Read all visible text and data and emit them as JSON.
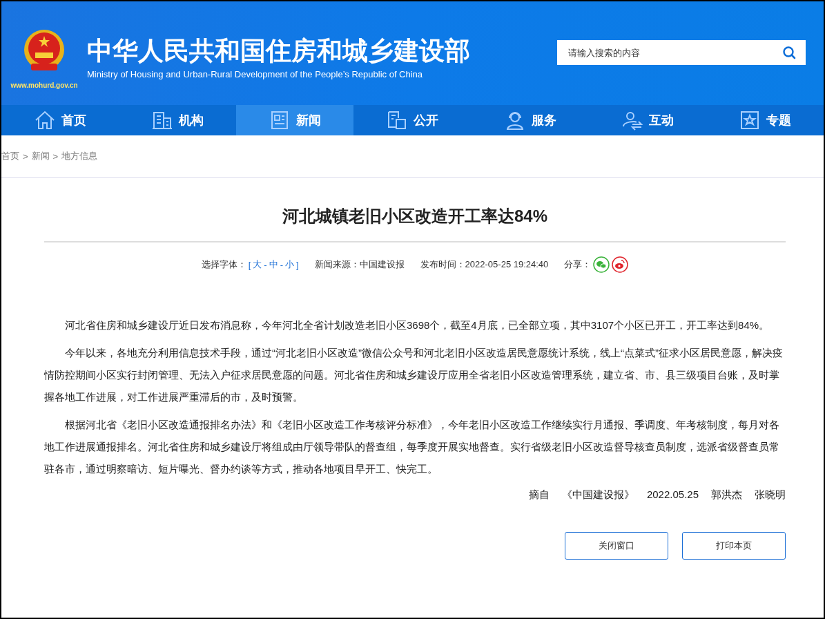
{
  "header": {
    "title": "中华人民共和国住房和城乡建设部",
    "subtitle": "Ministry of Housing and Urban-Rural Development of the People’s Republic of China",
    "url": "www.mohurd.gov.cn",
    "search": {
      "placeholder": "请输入搜索的内容"
    }
  },
  "nav": [
    {
      "label": "首页",
      "selected": false
    },
    {
      "label": "机构",
      "selected": false
    },
    {
      "label": "新闻",
      "selected": true
    },
    {
      "label": "公开",
      "selected": false
    },
    {
      "label": "服务",
      "selected": false
    },
    {
      "label": "互动",
      "selected": false
    },
    {
      "label": "专题",
      "selected": false
    }
  ],
  "breadcrumb": {
    "separator": ">",
    "items": [
      "首页",
      "新闻",
      "地方信息"
    ]
  },
  "article": {
    "title": "河北城镇老旧小区改造开工率达84%",
    "meta": {
      "font_label": "选择字体：",
      "font_open": "[",
      "font_close": "]",
      "font_sep": "-",
      "font_sizes": [
        "大",
        "中",
        "小"
      ],
      "source": "新闻来源：中国建设报",
      "time": "发布时间：2022-05-25 19:24:40",
      "share": "分享："
    },
    "paragraphs": [
      "河北省住房和城乡建设厅近日发布消息称，今年河北全省计划改造老旧小区3698个，截至4月底，已全部立项，其中3107个小区已开工，开工率达到84%。",
      "今年以来，各地充分利用信息技术手段，通过“河北老旧小区改造”微信公众号和河北老旧小区改造居民意愿统计系统，线上“点菜式”征求小区居民意愿，解决疫情防控期间小区实行封闭管理、无法入户征求居民意愿的问题。河北省住房和城乡建设厅应用全省老旧小区改造管理系统，建立省、市、县三级项目台账，及时掌握各地工作进展，对工作进展严重滞后的市，及时预警。",
      "根据河北省《老旧小区改造通报排名办法》和《老旧小区改造工作考核评分标准》，今年老旧小区改造工作继续实行月通报、季调度、年考核制度，每月对各地工作进展通报排名。河北省住房和城乡建设厅将组成由厅领导带队的督查组，每季度开展实地督查。实行省级老旧小区改造督导核查员制度，选派省级督查员常驻各市，通过明察暗访、短片曝光、督办约谈等方式，推动各地项目早开工、快完工。"
    ],
    "byline": [
      "摘自",
      "《中国建设报》",
      "2022.05.25",
      "郭洪杰",
      "张晓明"
    ]
  },
  "buttons": [
    "关闭窗口",
    "打印本页"
  ]
}
